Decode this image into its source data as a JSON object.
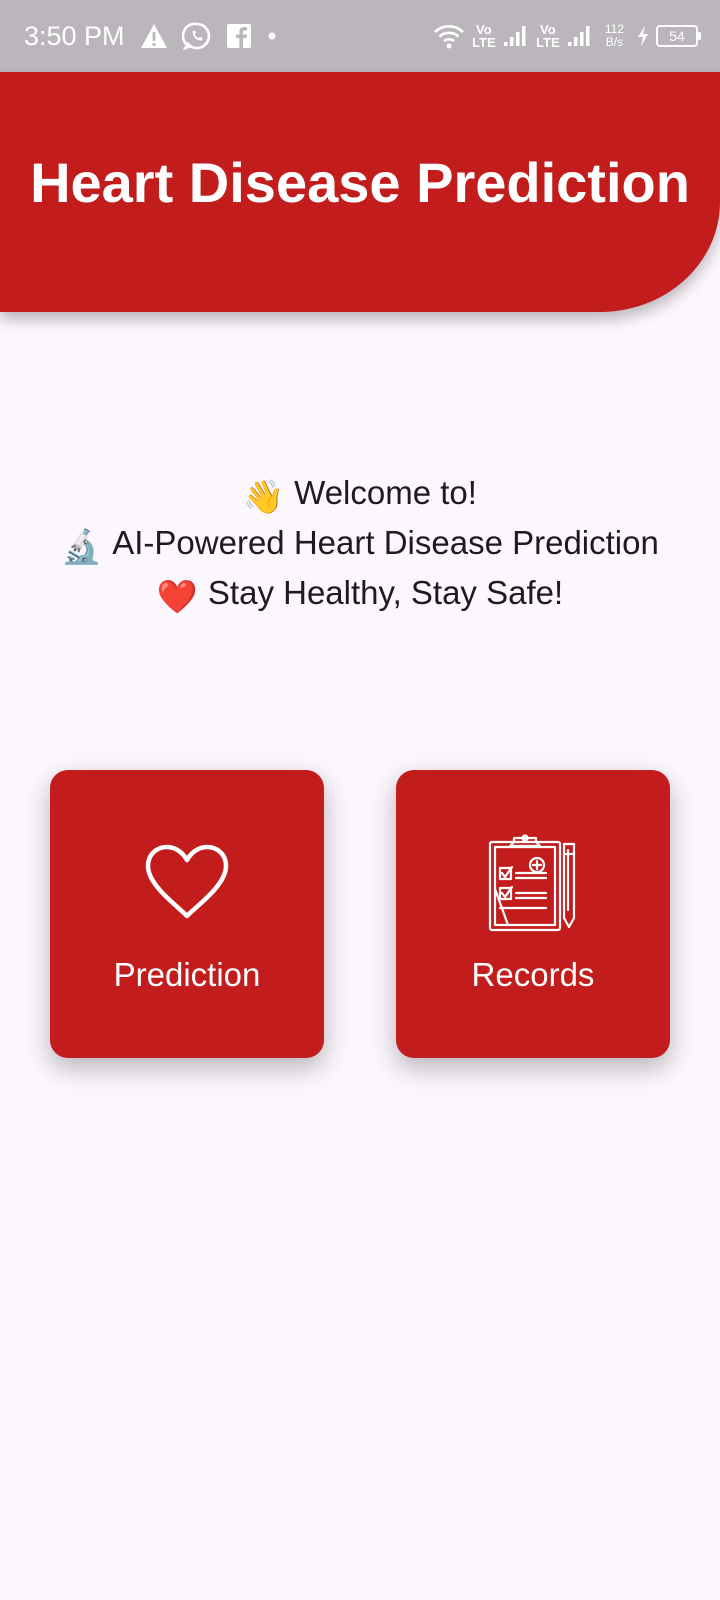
{
  "status_bar": {
    "time": "3:50 PM",
    "icons_left": [
      "alert-icon",
      "whatsapp-icon",
      "facebook-icon",
      "dot-icon"
    ],
    "volte_1": "Vo LTE",
    "volte_2": "Vo LTE",
    "net_speed_value": "112",
    "net_speed_unit": "B/s",
    "battery_level": "54"
  },
  "header": {
    "title": "Heart Disease Prediction",
    "background_color": "#C21C1C"
  },
  "welcome": {
    "line1_emoji": "👋",
    "line1_text": "Welcome to!",
    "line2_emoji": "🔬",
    "line2_text": "AI-Powered Heart Disease Prediction",
    "line3_emoji": "❤️",
    "line3_text": "Stay Healthy, Stay Safe!"
  },
  "cards": {
    "prediction": {
      "label": "Prediction",
      "icon": "heart-outline-icon"
    },
    "records": {
      "label": "Records",
      "icon": "clipboard-records-icon"
    }
  },
  "colors": {
    "accent": "#C21C1C",
    "background": "#FCF7FD",
    "status_bar": "#BAB6BB",
    "text": "#1D1B20"
  }
}
